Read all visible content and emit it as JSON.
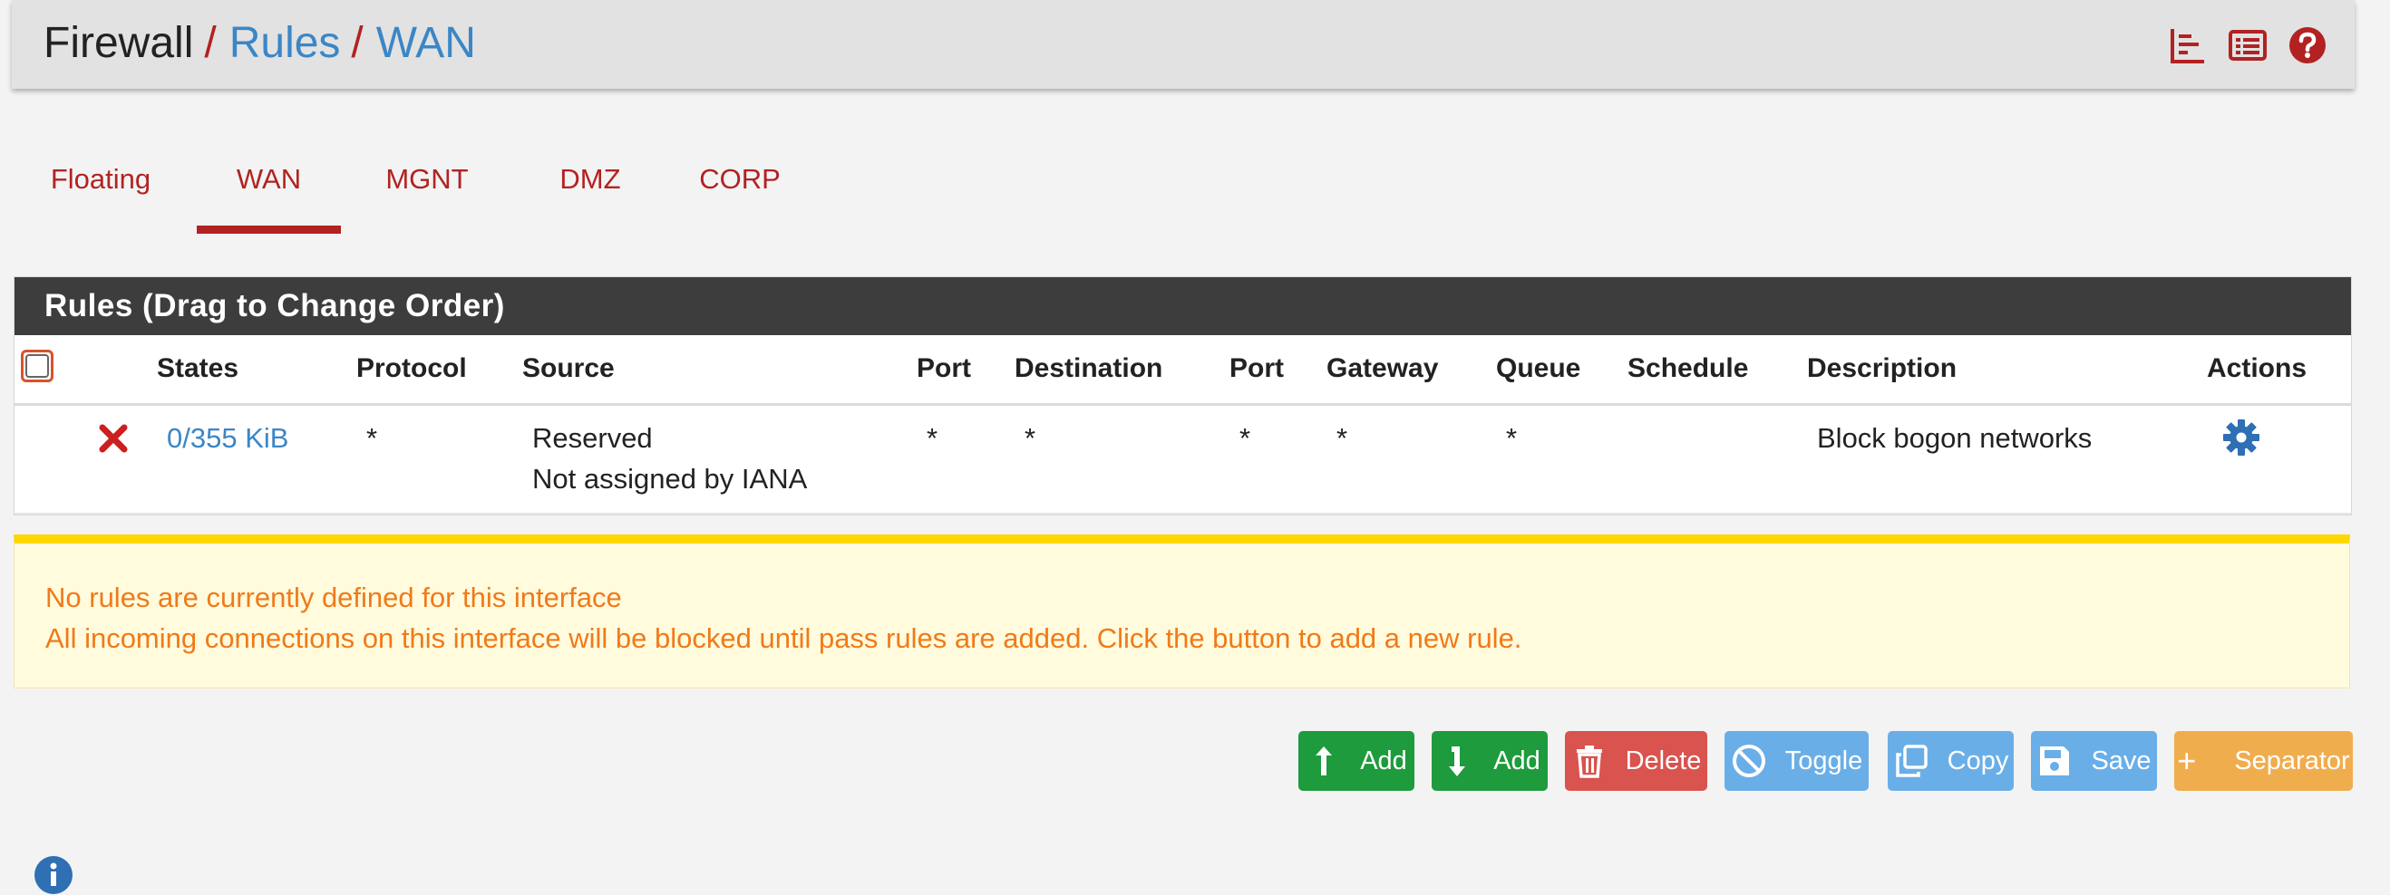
{
  "breadcrumb": {
    "root": "Firewall",
    "sep": "/",
    "items": [
      "Rules",
      "WAN"
    ]
  },
  "header_icons": [
    "chart-icon",
    "list-icon",
    "help-icon"
  ],
  "tabs": [
    {
      "label": "Floating",
      "active": false
    },
    {
      "label": "WAN",
      "active": true
    },
    {
      "label": "MGNT",
      "active": false
    },
    {
      "label": "DMZ",
      "active": false
    },
    {
      "label": "CORP",
      "active": false
    }
  ],
  "rules": {
    "title": "Rules (Drag to Change Order)",
    "columns": [
      "States",
      "Protocol",
      "Source",
      "Port",
      "Destination",
      "Port",
      "Gateway",
      "Queue",
      "Schedule",
      "Description",
      "Actions"
    ],
    "row": {
      "status_icon": "block-x-icon",
      "states": "0/355 KiB",
      "protocol": "*",
      "source_line1": "Reserved",
      "source_line2": "Not assigned by IANA",
      "source_port": "*",
      "destination": "*",
      "destination_port": "*",
      "gateway": "*",
      "queue": "*",
      "schedule": "",
      "description": "Block bogon networks",
      "action_icon": "gear-icon"
    }
  },
  "alert": {
    "line1": "No rules are currently defined for this interface",
    "line2": "All incoming connections on this interface will be blocked until pass rules are added. Click the button to add a new rule."
  },
  "buttons": {
    "add_top": "Add",
    "add_bottom": "Add",
    "delete": "Delete",
    "toggle": "Toggle",
    "copy": "Copy",
    "save": "Save",
    "separator": "Separator"
  },
  "colors": {
    "accent_red": "#b22222",
    "link_blue": "#3b86c6",
    "alert_orange": "#f07a1a",
    "alert_bar": "#ffd700",
    "btn_green": "#1e9b3c",
    "btn_red": "#d9534f",
    "btn_blue": "#6aaee8",
    "btn_orange": "#f0ad4e"
  }
}
